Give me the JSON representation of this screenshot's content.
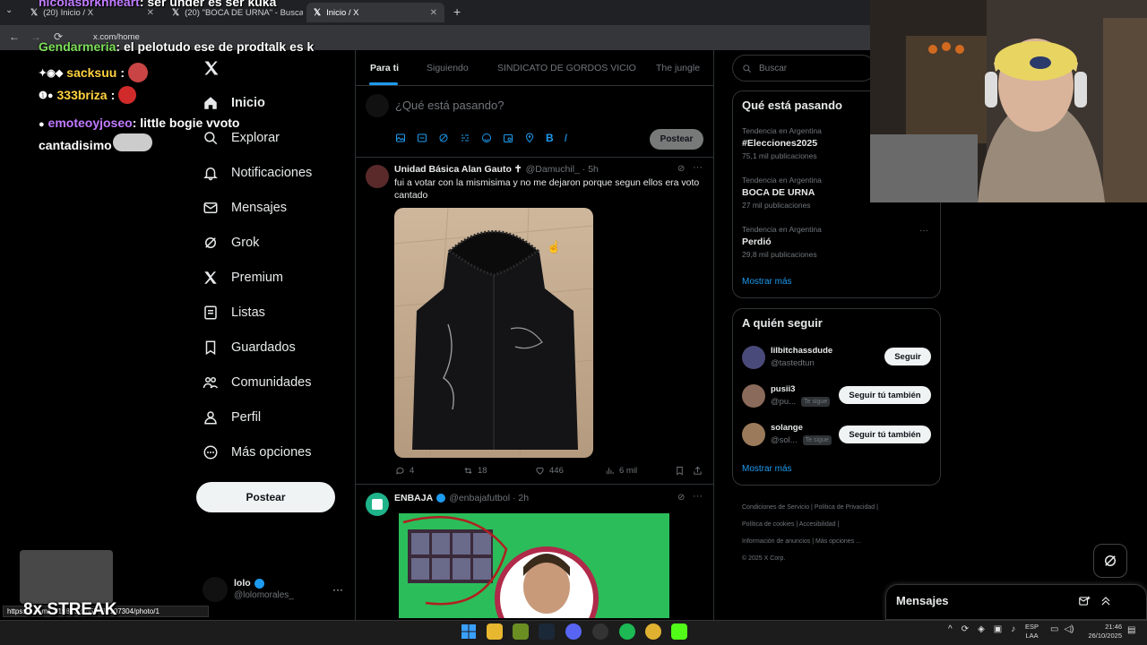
{
  "browser": {
    "tabs": [
      {
        "label": "(20) Inicio / X"
      },
      {
        "label": "(20) \"BOCA DE URNA\" - Buscar"
      },
      {
        "label": "Inicio / X"
      }
    ],
    "url": "x.com/home",
    "status_url": "https://x.com/.../1982522655032107304/photo/1"
  },
  "nav": {
    "items": [
      {
        "label": "Inicio",
        "icon": "home-icon"
      },
      {
        "label": "Explorar",
        "icon": "search-icon"
      },
      {
        "label": "Notificaciones",
        "icon": "bell-icon"
      },
      {
        "label": "Mensajes",
        "icon": "mail-icon"
      },
      {
        "label": "Grok",
        "icon": "grok-icon"
      },
      {
        "label": "Premium",
        "icon": "x-logo-icon"
      },
      {
        "label": "Listas",
        "icon": "list-icon"
      },
      {
        "label": "Guardados",
        "icon": "bookmark-icon"
      },
      {
        "label": "Comunidades",
        "icon": "communities-icon"
      },
      {
        "label": "Perfil",
        "icon": "person-icon"
      },
      {
        "label": "Más opciones",
        "icon": "more-icon"
      }
    ],
    "post_button": "Postear",
    "account": {
      "name": "lolo",
      "handle": "@lolomorales_"
    }
  },
  "feed": {
    "tabs": [
      "Para ti",
      "Siguiendo",
      "SINDICATO DE GORDOS VICIO",
      "The jungle"
    ],
    "composer_placeholder": "¿Qué está pasando?",
    "composer_button": "Postear",
    "tweets": [
      {
        "name": "Unidad Básica Alan Gauto ✝",
        "handle": "@Damuchil_ · 5h",
        "text": "fui a votar con la mismisima y no me dejaron porque segun ellos era voto cantado",
        "replies": "4",
        "reposts": "18",
        "likes": "446",
        "views": "6 mil"
      },
      {
        "name": "ENBAJA",
        "handle": "@enbajafutbol · 2h"
      }
    ]
  },
  "sidebar": {
    "search_placeholder": "Buscar",
    "trends_title": "Qué está pasando",
    "trends": [
      {
        "meta": "Tendencia en Argentina",
        "name": "#Elecciones2025",
        "count": "75,1 mil publicaciones"
      },
      {
        "meta": "Tendencia en Argentina",
        "name": "BOCA DE URNA",
        "count": "27 mil publicaciones"
      },
      {
        "meta": "Tendencia en Argentina",
        "name": "Perdió",
        "count": "29,8 mil publicaciones"
      }
    ],
    "trends_more": "Mostrar más",
    "follow_title": "A quién seguir",
    "follow": [
      {
        "name": "lilbitchassdude",
        "handle": "@tastedtun",
        "badge": "",
        "button": "Seguir"
      },
      {
        "name": "pusii3",
        "handle": "@pu...",
        "badge": "Te sigue",
        "button": "Seguir tú también"
      },
      {
        "name": "solange",
        "handle": "@sol...",
        "badge": "Te sigue",
        "button": "Seguir tú también"
      }
    ],
    "follow_more": "Mostrar más",
    "footer": [
      "Condiciones de Servicio",
      "Política de Privacidad",
      "Política de cookies",
      "Accesibilidad",
      "Información de anuncios",
      "Más opciones ...",
      "© 2025 X Corp."
    ]
  },
  "messages_drawer": {
    "title": "Mensajes"
  },
  "chat_overlay": [
    {
      "user": "nicolasbrkhheart",
      "text": "ser under es ser kuka",
      "color": "#c07bff"
    },
    {
      "user": "Gendarmeria",
      "text": "el pelotudo ese de prodtalk es k",
      "color": "#7ee05a"
    },
    {
      "user": "sacksuu",
      "text": "",
      "color": "#ffd23f"
    },
    {
      "user": "333briza",
      "text": "",
      "color": "#ffd23f"
    },
    {
      "user": "emoteoyjoseo",
      "text": "little bogie vvoto cantadisimo",
      "color": "#c07bff"
    }
  ],
  "streak": "8x STREAK",
  "taskbar": {
    "lang": "ESP",
    "layout": "LAA",
    "time": "21:46",
    "date": "26/10/2025"
  },
  "colors": {
    "accent": "#1d9bf0",
    "background": "#000000",
    "border": "#2f3336",
    "muted": "#71767b"
  }
}
